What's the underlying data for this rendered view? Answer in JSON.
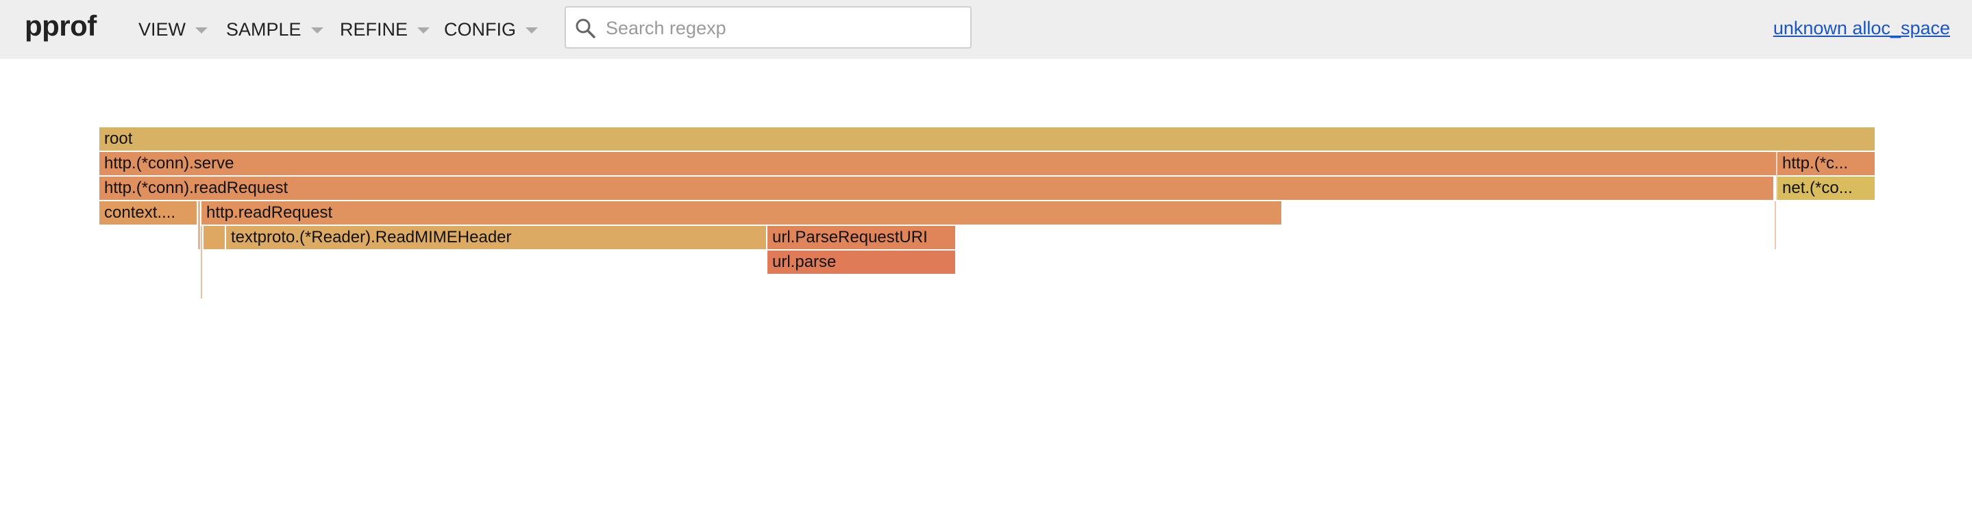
{
  "app": {
    "logo": "pprof",
    "menus": [
      {
        "label": "VIEW"
      },
      {
        "label": "SAMPLE"
      },
      {
        "label": "REFINE"
      },
      {
        "label": "CONFIG"
      }
    ],
    "search": {
      "placeholder": "Search regexp",
      "value": ""
    },
    "profile_link": "unknown alloc_space"
  },
  "flamegraph": {
    "frames": [
      {
        "label": "root",
        "color": "#d8b264"
      },
      {
        "label": "http.(*conn).serve",
        "color": "#e0905e"
      },
      {
        "label": "http.(*c...",
        "color": "#e0905e"
      },
      {
        "label": "http.(*conn).readRequest",
        "color": "#e0905e"
      },
      {
        "label": "net.(*co...",
        "color": "#d9bc5e"
      },
      {
        "label": "context....",
        "color": "#df9c5e"
      },
      {
        "label": "http.readRequest",
        "color": "#e0935f"
      },
      {
        "label": "",
        "color": "#dfa862"
      },
      {
        "label": "textproto.(*Reader).ReadMIMEHeader",
        "color": "#dcaa62"
      },
      {
        "label": "url.ParseRequestURI",
        "color": "#e0845a"
      },
      {
        "label": "url.parse",
        "color": "#e07b58"
      }
    ],
    "slivers": [
      {
        "color": "#e6b48c"
      },
      {
        "color": "#e8c0a0"
      },
      {
        "color": "#f0c8b0"
      },
      {
        "color": "#e8d8c8"
      }
    ]
  }
}
